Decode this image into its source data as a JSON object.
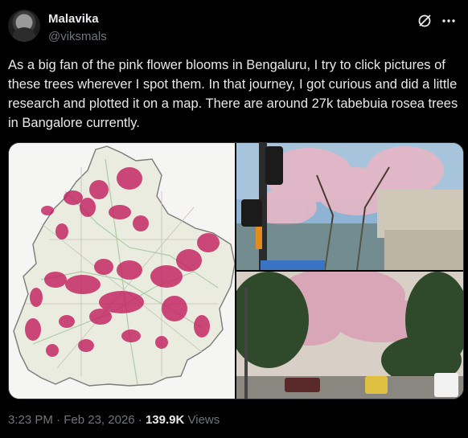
{
  "author": {
    "display_name": "Malavika",
    "handle": "@viksmals"
  },
  "header_icons": {
    "grok": "grok-icon",
    "more": "more-icon"
  },
  "tweet": {
    "text": "As a big fan of the pink flower blooms in Bengaluru, I try to click pictures of these trees wherever I spot them. In that journey, I got curious and did a little research and plotted it on a map. There are around 27k tabebuia rosea trees in Bangalore currently."
  },
  "media": {
    "items": [
      "map",
      "photo",
      "photo"
    ]
  },
  "meta": {
    "time": "3:23 PM",
    "separator": " · ",
    "date": "Feb 23, 2026",
    "separator2": " · ",
    "views_count": "139.9K",
    "views_label": " Views"
  },
  "colors": {
    "background": "#000000",
    "text_primary": "#e7e9ea",
    "text_secondary": "#71767b",
    "border": "#2f3336",
    "bloom_pink": "#c2185b"
  }
}
